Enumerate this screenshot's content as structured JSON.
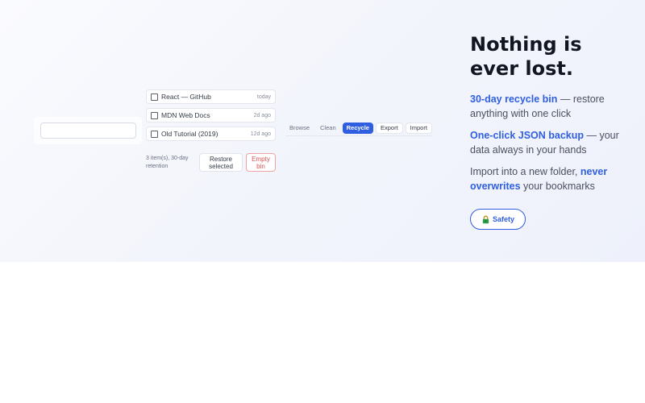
{
  "search": {
    "placeholder": "",
    "value": ""
  },
  "bin": {
    "items": [
      {
        "title": "React — GitHub",
        "age": "today"
      },
      {
        "title": "MDN Web Docs",
        "age": "2d ago"
      },
      {
        "title": "Old Tutorial (2019)",
        "age": "12d ago"
      }
    ],
    "status": "3 item(s), 30-day retention",
    "restore_label": "Restore selected",
    "empty_label": "Empty bin"
  },
  "tabs": [
    {
      "label": "Browse",
      "active": false
    },
    {
      "label": "Clean",
      "active": false
    },
    {
      "label": "Recycle",
      "active": true
    },
    {
      "label": "Export",
      "active": false
    },
    {
      "label": "Import",
      "active": false
    }
  ],
  "copy": {
    "headline_line1": "Nothing is",
    "headline_line2": "ever lost.",
    "features": [
      {
        "highlight": "30-day recycle bin",
        "text": " — restore anything with one click"
      },
      {
        "highlight": "One-click JSON backup",
        "text": " — your data always in your hands"
      },
      {
        "pre": "Import into a new folder, ",
        "highlight": "never overwrites",
        "text": " your bookmarks"
      }
    ],
    "pill_label": "Safety",
    "pill_icon": "padlock-icon"
  },
  "colors": {
    "accent": "#2f5fe0",
    "danger": "#e05252",
    "heading": "#111622",
    "hero_bg": "#f3f5fc"
  }
}
